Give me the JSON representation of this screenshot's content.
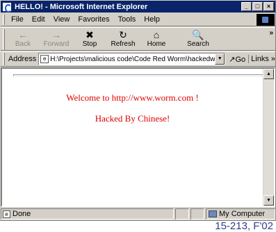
{
  "window": {
    "title": "HELLO! - Microsoft Internet Explorer",
    "controls": {
      "minimize": "_",
      "maximize": "□",
      "close": "×"
    }
  },
  "menubar": {
    "items": [
      {
        "label": "File"
      },
      {
        "label": "Edit"
      },
      {
        "label": "View"
      },
      {
        "label": "Favorites"
      },
      {
        "label": "Tools"
      },
      {
        "label": "Help"
      }
    ]
  },
  "toolbar": {
    "back_label": "Back",
    "forward_label": "Forward",
    "stop_label": "Stop",
    "refresh_label": "Refresh",
    "home_label": "Home",
    "search_label": "Search",
    "more": "»",
    "icons": {
      "back": "←",
      "forward": "→",
      "stop": "✖",
      "refresh": "↻",
      "home": "⌂",
      "search": "🔍"
    }
  },
  "addressbar": {
    "label": "Address",
    "value": "H:\\Projects\\malicious code\\Code Red Worm\\hackedwe",
    "go_label": "Go",
    "links_label": "Links »"
  },
  "page": {
    "line1": "Welcome to http://www.worm.com !",
    "line2": "Hacked By Chinese!",
    "text_color": "#e00000"
  },
  "statusbar": {
    "status_text": "Done",
    "zone_text": "My Computer"
  },
  "footer": {
    "text": "15-213, F'02"
  },
  "colors": {
    "titlebar": "#0a246a",
    "chrome": "#d4d0c8"
  }
}
